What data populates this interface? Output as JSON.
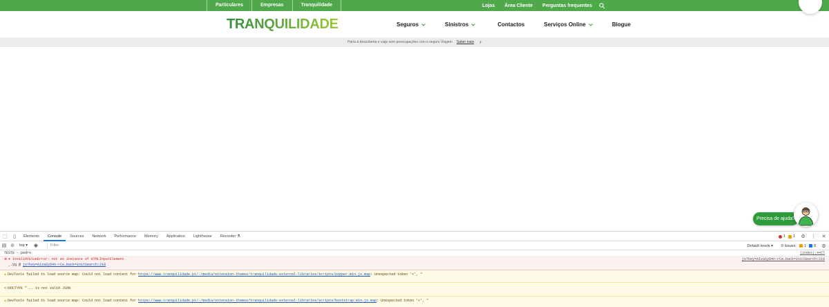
{
  "topbar": {
    "segments": [
      "Particulares",
      "Empresas",
      "Tranquilidade"
    ],
    "utility_links": [
      "Lojas",
      "Área Cliente",
      "Perguntas frequentes"
    ]
  },
  "header": {
    "logo_text": "TRANQUILIDADE",
    "nav": [
      "Seguros",
      "Sinistros",
      "Contactos",
      "Serviços Online",
      "Blogue"
    ]
  },
  "announcement": {
    "text": "Parta à descoberta e viaje sem preocupações com o seguro Viagem",
    "link": "Saber mais",
    "arrow": "›"
  },
  "help_widget": {
    "label": "Precisa de ajuda?"
  },
  "devtools": {
    "tabs": [
      "Elements",
      "Console",
      "Sources",
      "Network",
      "Performance",
      "Memory",
      "Application",
      "Lighthouse",
      "Recorder"
    ],
    "active_tab": "Console",
    "error_count": "1",
    "warning_count": "1",
    "context": "top",
    "filter_placeholder": "Filter",
    "levels": "Default levels",
    "issues_label": "9 Issues:",
    "issues_warn": "1",
    "issues_info": "8",
    "messages": {
      "log_text": "TESTE - pedro",
      "log_src": "(index):4427",
      "err_text": "InvalidValueError: not an instance of HTMLInputElement",
      "err_stack_prefix": "_.yg @ ",
      "err_stack_link": "js?key=AIzaSyD4n-rCe…back=initSearch:218",
      "err_src": "js?key=AIzaSyD4n-rCe…back=initSearch:218",
      "warn1_prefix": "DevTools failed to load source map: Could not load content for ",
      "warn1_link": "https://www.tranquilidade.pt/-/media/extension-themes/tranquilidade-external-libraries/scripts/popper.min.js.map",
      "warn1_suffix": ": Unexpected token '<', \"",
      "warn1_line2": "<!DOCTYPE \"... is not valid JSON",
      "warn2_prefix": "DevTools failed to load source map: Could not load content for ",
      "warn2_link": "https://www.tranquilidade.pt/-/media/extension-themes/tranquilidade-external-libraries/scripts/bootstrap.min.js.map",
      "warn2_suffix": ": Unexpected token '<', \""
    }
  },
  "colors": {
    "brand_green": "#4fa94b",
    "help_green": "#2e9a3c",
    "error_red": "#d93025",
    "warning_amber": "#e8a100"
  }
}
